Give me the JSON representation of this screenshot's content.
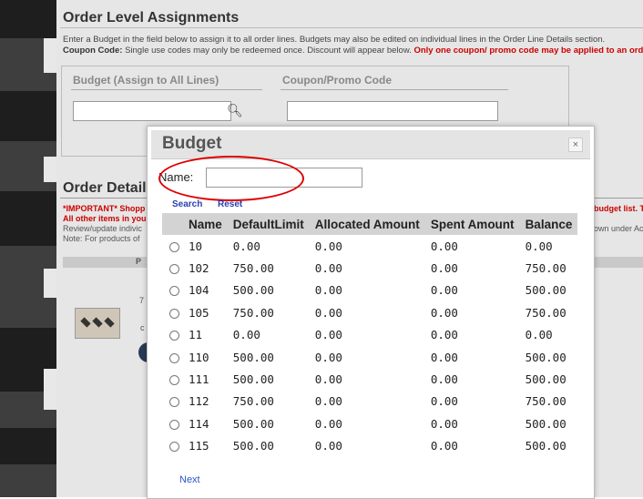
{
  "order_level": {
    "title": "Order Level Assignments",
    "desc_line1": "Enter a Budget in the field below to assign it to all order lines. Budgets may also be edited on individual lines in the Order Line Details section.",
    "coupon_label": "Coupon Code:",
    "coupon_text": " Single use codes may only be redeemed once. Discount will appear below. ",
    "coupon_warning": "Only one coupon/ promo code may be applied to an order.",
    "budget_header": "Budget (Assign to All Lines)",
    "coupon_header": "Coupon/Promo Code"
  },
  "order_details": {
    "title": "Order Details",
    "important_prefix": "*IMPORTANT* Shopp",
    "other_items": "All other items in you",
    "review": "Review/update indivic",
    "note": "Note: For products of",
    "right_red": "budget list. T",
    "right_grey": "own under Ac",
    "bar_letter": "P",
    "side_number": "7",
    "side_c": "c"
  },
  "modal": {
    "title": "Budget",
    "close_symbol": "×",
    "name_label": "Name:",
    "name_value": "",
    "search_label": "Search",
    "reset_label": "Reset",
    "next_label": "Next",
    "columns": [
      "Name",
      "DefaultLimit",
      "Allocated Amount",
      "Spent Amount",
      "Balance"
    ],
    "rows": [
      [
        "10",
        "0.00",
        "0.00",
        "0.00",
        "0.00"
      ],
      [
        "102",
        "750.00",
        "0.00",
        "0.00",
        "750.00"
      ],
      [
        "104",
        "500.00",
        "0.00",
        "0.00",
        "500.00"
      ],
      [
        "105",
        "750.00",
        "0.00",
        "0.00",
        "750.00"
      ],
      [
        "11",
        "0.00",
        "0.00",
        "0.00",
        "0.00"
      ],
      [
        "110",
        "500.00",
        "0.00",
        "0.00",
        "500.00"
      ],
      [
        "111",
        "500.00",
        "0.00",
        "0.00",
        "500.00"
      ],
      [
        "112",
        "750.00",
        "0.00",
        "0.00",
        "750.00"
      ],
      [
        "114",
        "500.00",
        "0.00",
        "0.00",
        "500.00"
      ],
      [
        "115",
        "500.00",
        "0.00",
        "0.00",
        "500.00"
      ]
    ]
  },
  "colors": {
    "accent_red": "#cc0000",
    "link_blue": "#2a3fb0",
    "highlight_red": "#dd0000"
  }
}
